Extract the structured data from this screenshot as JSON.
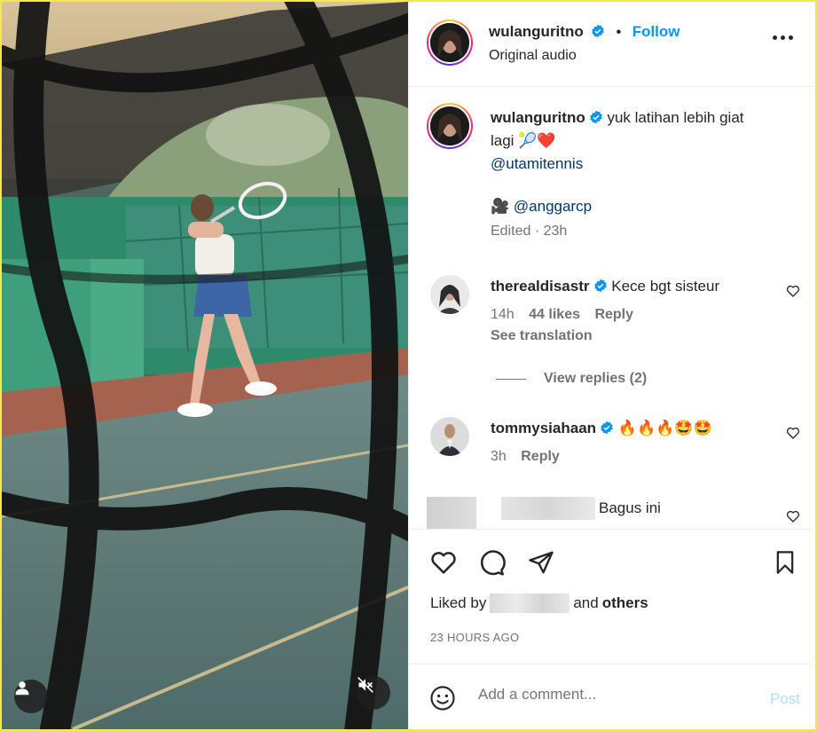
{
  "post_header": {
    "username": "wulanguritno",
    "separator": "•",
    "follow_label": "Follow",
    "subtitle": "Original audio",
    "more_icon": "more-horizontal-icon"
  },
  "caption": {
    "username": "wulanguritno",
    "text_line1": "yuk latihan lebih giat",
    "text_line2": "lagi",
    "emojis": "🎾❤️",
    "mention1": "@utamitennis",
    "camera_emoji": "🎥",
    "mention2": "@anggarcp",
    "meta": "Edited · 23h"
  },
  "comments": [
    {
      "username": "therealdisastr",
      "text": "Kece bgt sisteur",
      "time": "14h",
      "likes": "44 likes",
      "reply_label": "Reply",
      "see_translation": "See translation",
      "view_replies": "View replies (2)"
    },
    {
      "username": "tommysiahaan",
      "text": "🔥🔥🔥🤩🤩",
      "time": "3h",
      "reply_label": "Reply"
    },
    {
      "username": "",
      "text": "Bagus ini"
    }
  ],
  "actions": {
    "icons": [
      "heart-icon",
      "comment-icon",
      "share-icon",
      "bookmark-icon"
    ],
    "liked_by_prefix": "Liked by",
    "liked_by_and": "and",
    "liked_by_others": "others",
    "timestamp": "23 HOURS AGO"
  },
  "add_comment": {
    "placeholder": "Add a comment...",
    "post_label": "Post",
    "emoji_icon": "smiley-icon"
  },
  "media": {
    "user_tag_icon": "person-icon",
    "mute_icon": "speaker-muted-icon"
  },
  "colors": {
    "accent": "#0095f6",
    "mention": "#00376b",
    "secondary_text": "#737373",
    "post_disabled": "#b3dbff",
    "verified": "#0095f6"
  }
}
